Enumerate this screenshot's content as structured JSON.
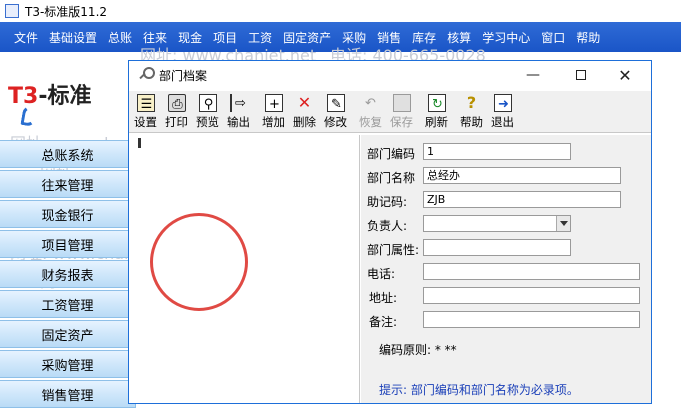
{
  "app": {
    "title": "T3-标准版11.2"
  },
  "menu": [
    "文件",
    "基础设置",
    "总账",
    "往来",
    "现金",
    "项目",
    "工资",
    "固定资产",
    "采购",
    "销售",
    "库存",
    "核算",
    "学习中心",
    "窗口",
    "帮助"
  ],
  "background": {
    "logo_t3": "T3",
    "logo_rest": "-标准",
    "watermarks": [
      "网址: www.chanjet.net",
      "电话: 400-665-0028",
      "网址: www.chanjet.net",
      "电话: 400-665-0028",
      "网址: www.chanjet.net",
      "电话: 400-665-0028",
      "网址: www.chanjet.net",
      "电话: 400-665-0028",
      "网址: www.chanjet.net",
      "电话: 400-665-0028",
      "网址: www.chanjet.net",
      "电话: 400-665-0028",
      "网址: www.chanjet.net",
      "网址: www.chanjet.net"
    ]
  },
  "sidebar": [
    "总账系统",
    "往来管理",
    "现金银行",
    "项目管理",
    "财务报表",
    "工资管理",
    "固定资产",
    "采购管理",
    "销售管理"
  ],
  "dialog": {
    "title": "部门档案",
    "toolbar": [
      {
        "label": "设置",
        "icon": "settings-icon",
        "enabled": true
      },
      {
        "label": "打印",
        "icon": "print-icon",
        "enabled": true
      },
      {
        "label": "预览",
        "icon": "preview-icon",
        "enabled": true
      },
      {
        "label": "输出",
        "icon": "export-icon",
        "enabled": true
      },
      {
        "label": "增加",
        "icon": "add-icon",
        "enabled": true
      },
      {
        "label": "删除",
        "icon": "delete-icon",
        "enabled": true
      },
      {
        "label": "修改",
        "icon": "edit-icon",
        "enabled": true
      },
      {
        "label": "恢复",
        "icon": "undo-icon",
        "enabled": false
      },
      {
        "label": "保存",
        "icon": "save-icon",
        "enabled": false
      },
      {
        "label": "刷新",
        "icon": "refresh-icon",
        "enabled": true
      },
      {
        "label": "帮助",
        "icon": "help-icon",
        "enabled": true
      },
      {
        "label": "退出",
        "icon": "exit-icon",
        "enabled": true
      }
    ],
    "form": {
      "dept_code_label": "部门编码",
      "dept_code_value": "1",
      "dept_name_label": "部门名称",
      "dept_name_value": "总经办",
      "mnemonic_label": "助记码:",
      "mnemonic_value": "ZJB",
      "manager_label": "负责人:",
      "manager_value": "",
      "attribute_label": "部门属性:",
      "attribute_value": "",
      "phone_label": "电话:",
      "phone_value": "",
      "address_label": "地址:",
      "address_value": "",
      "remark_label": "备注:",
      "remark_value": "",
      "code_rule": "编码原则: * **",
      "hint": "提示: 部门编码和部门名称为必录项。"
    }
  },
  "colors": {
    "menubar": "#1a55c7",
    "sidebar": "#b9dbf6",
    "dialog_border": "#1e6fd9",
    "hint_text": "#1a3fb8",
    "annotation_circle": "#e04a44"
  }
}
